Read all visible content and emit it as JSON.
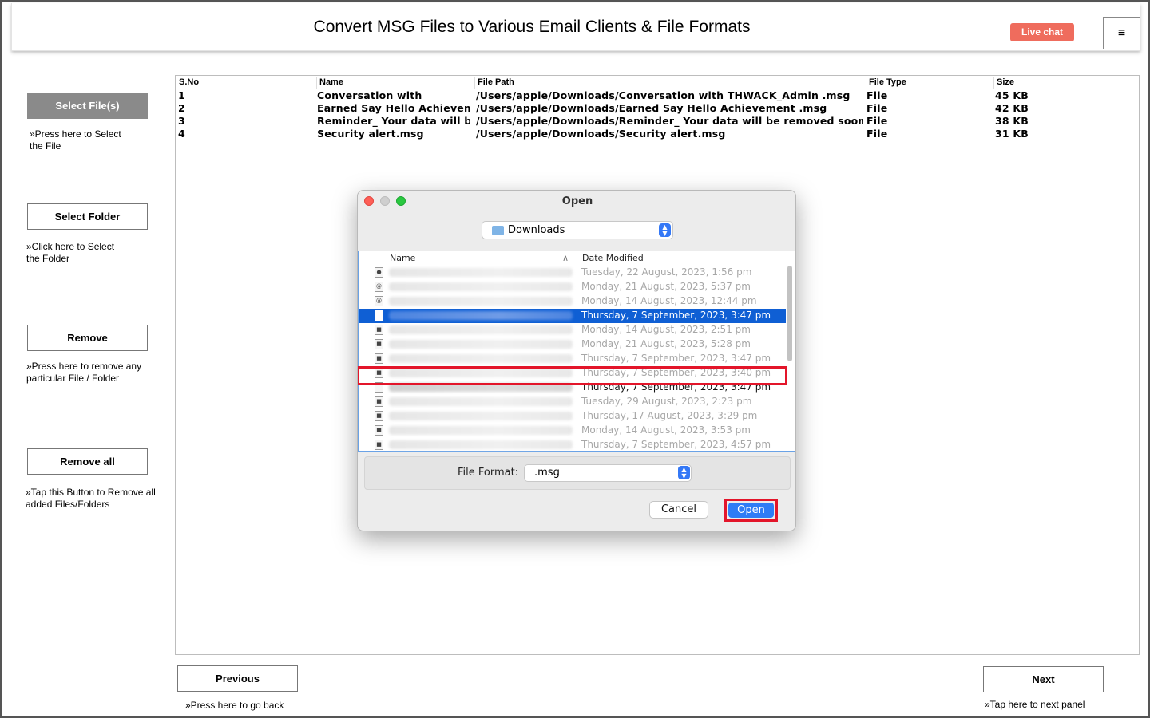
{
  "header": {
    "title": "Convert MSG Files to Various Email Clients & File Formats",
    "live_chat": "Live chat",
    "menu_glyph": "≡"
  },
  "sidebar": {
    "select_files": {
      "label": "Select File(s)",
      "hint": "»Press here to Select the File"
    },
    "select_folder": {
      "label": "Select Folder",
      "hint": "»Click here to Select the Folder"
    },
    "remove": {
      "label": "Remove",
      "hint": "»Press here to remove any particular File / Folder"
    },
    "remove_all": {
      "label": "Remove all",
      "hint": "»Tap this Button to Remove all added Files/Folders"
    }
  },
  "table": {
    "columns": [
      "S.No",
      "Name",
      "File Path",
      "File Type",
      "Size"
    ],
    "rows": [
      {
        "sno": "1",
        "name": "Conversation with",
        "path": "/Users/apple/Downloads/Conversation with THWACK_Admin .msg",
        "type": "File",
        "size": "45 KB"
      },
      {
        "sno": "2",
        "name": "Earned Say Hello Achievement",
        "path": "/Users/apple/Downloads/Earned Say Hello Achievement .msg",
        "type": "File",
        "size": "42 KB"
      },
      {
        "sno": "3",
        "name": "Reminder_ Your data will be",
        "path": "/Users/apple/Downloads/Reminder_ Your data will be removed soon.msg",
        "type": "File",
        "size": "38 KB"
      },
      {
        "sno": "4",
        "name": "Security alert.msg",
        "path": "/Users/apple/Downloads/Security alert.msg",
        "type": "File",
        "size": "31 KB"
      }
    ]
  },
  "footer": {
    "previous": {
      "label": "Previous",
      "hint": "»Press here to go back"
    },
    "next": {
      "label": "Next",
      "hint": "»Tap here to next panel"
    }
  },
  "dialog": {
    "title": "Open",
    "location": "Downloads",
    "col_name": "Name",
    "col_date": "Date Modified",
    "sort_glyph": "∧",
    "files": [
      {
        "date": "Tuesday, 22 August, 2023, 1:56 pm",
        "state": "dim",
        "icon": "disk-icon"
      },
      {
        "date": "Monday, 21 August, 2023, 5:37 pm",
        "state": "dim",
        "icon": "contact-file-icon"
      },
      {
        "date": "Monday, 14 August, 2023, 12:44 pm",
        "state": "dim",
        "icon": "contact-file-icon"
      },
      {
        "date": "Thursday, 7 September, 2023, 3:47 pm",
        "state": "selected",
        "icon": "document-icon"
      },
      {
        "date": "Monday, 14 August, 2023, 2:51 pm",
        "state": "dim",
        "icon": "locked-file-icon"
      },
      {
        "date": "Monday, 21 August, 2023, 5:28 pm",
        "state": "dim",
        "icon": "locked-file-icon"
      },
      {
        "date": "Thursday, 7 September, 2023, 3:47 pm",
        "state": "dim",
        "icon": "locked-file-icon"
      },
      {
        "date": "Thursday, 7 September, 2023, 3:40 pm",
        "state": "dim",
        "icon": "locked-file-icon"
      },
      {
        "date": "Thursday, 7 September, 2023, 3:47 pm",
        "state": "dark",
        "icon": "document-icon"
      },
      {
        "date": "Tuesday, 29 August, 2023, 2:23 pm",
        "state": "dim",
        "icon": "locked-file-icon"
      },
      {
        "date": "Thursday, 17 August, 2023, 3:29 pm",
        "state": "dim",
        "icon": "locked-file-icon"
      },
      {
        "date": "Monday, 14 August, 2023, 3:53 pm",
        "state": "dim",
        "icon": "locked-file-icon"
      },
      {
        "date": "Thursday, 7 September, 2023, 4:57 pm",
        "state": "dim",
        "icon": "locked-file-icon"
      }
    ],
    "format_label": "File Format:",
    "format_value": ".msg",
    "cancel": "Cancel",
    "open": "Open"
  },
  "colors": {
    "accent": "#2f7cf6",
    "selection": "#0f5fd4",
    "highlight": "#e3152a",
    "live_chat": "#ef6c5d",
    "active_button": "#8a8a8a"
  }
}
